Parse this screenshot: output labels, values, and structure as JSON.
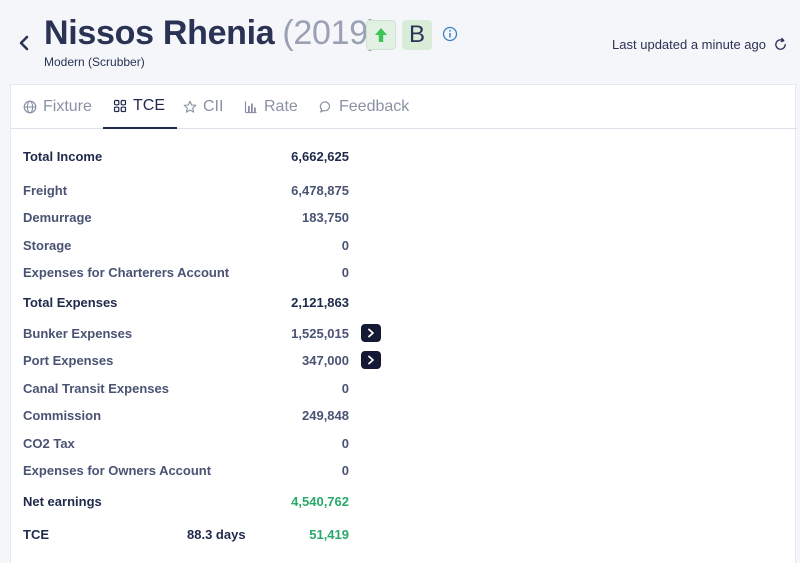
{
  "header": {
    "title": "Nissos Rhenia",
    "year": "(2019)",
    "grade": "B",
    "subtitle": "Modern (Scrubber)",
    "last_updated": "Last updated a minute ago",
    "colors": {
      "accent": "#1f2a4a",
      "positive": "#2aa86a",
      "up_arrow": "#3cc455"
    },
    "icons": [
      "back-chevron-icon",
      "up-arrow-icon",
      "info-icon",
      "refresh-icon"
    ]
  },
  "tabs": [
    {
      "label": "Fixture",
      "icon": "globe-icon",
      "active": false
    },
    {
      "label": "TCE",
      "icon": "grid-icon",
      "active": true
    },
    {
      "label": "CII",
      "icon": "star-icon",
      "active": false
    },
    {
      "label": "Rate",
      "icon": "bar-chart-icon",
      "active": false
    },
    {
      "label": "Feedback",
      "icon": "speech-bubble-icon",
      "active": false
    }
  ],
  "tce": {
    "total_income": {
      "label": "Total Income",
      "value": "6,662,625"
    },
    "freight": {
      "label": "Freight",
      "value": "6,478,875"
    },
    "demurrage": {
      "label": "Demurrage",
      "value": "183,750"
    },
    "storage": {
      "label": "Storage",
      "value": "0"
    },
    "charterers_account": {
      "label": "Expenses for Charterers Account",
      "value": "0"
    },
    "total_expenses": {
      "label": "Total Expenses",
      "value": "2,121,863"
    },
    "bunker_expenses": {
      "label": "Bunker Expenses",
      "value": "1,525,015"
    },
    "port_expenses": {
      "label": "Port Expenses",
      "value": "347,000"
    },
    "canal_transit": {
      "label": "Canal Transit Expenses",
      "value": "0"
    },
    "commission": {
      "label": "Commission",
      "value": "249,848"
    },
    "co2_tax": {
      "label": "CO2 Tax",
      "value": "0"
    },
    "owners_account": {
      "label": "Expenses for Owners Account",
      "value": "0"
    },
    "net_earnings": {
      "label": "Net earnings",
      "value": "4,540,762"
    },
    "tce": {
      "label": "TCE",
      "days": "88.3 days",
      "value": "51,419"
    }
  }
}
